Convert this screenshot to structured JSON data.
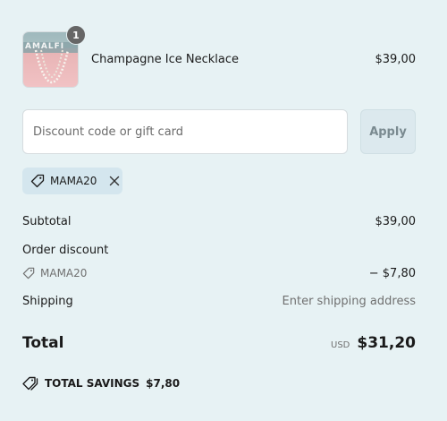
{
  "cart": {
    "item": {
      "thumbnail_text": "AMALFI",
      "quantity": "1",
      "name": "Champagne Ice Necklace",
      "price": "$39,00"
    }
  },
  "discount": {
    "placeholder": "Discount code or gift card",
    "apply_label": "Apply",
    "applied_code": "MAMA20"
  },
  "summary": {
    "subtotal_label": "Subtotal",
    "subtotal_value": "$39,00",
    "order_discount_label": "Order discount",
    "order_discount_code": "MAMA20",
    "order_discount_value": "− $7,80",
    "shipping_label": "Shipping",
    "shipping_value": "Enter shipping address",
    "total_label": "Total",
    "currency": "USD",
    "total_value": "$31,20",
    "savings_label": "TOTAL SAVINGS",
    "savings_value": "$7,80"
  },
  "colors": {
    "background": "#e7f2f4",
    "chip_background": "#d4e6ee",
    "apply_disabled_bg": "#dce9ee"
  }
}
